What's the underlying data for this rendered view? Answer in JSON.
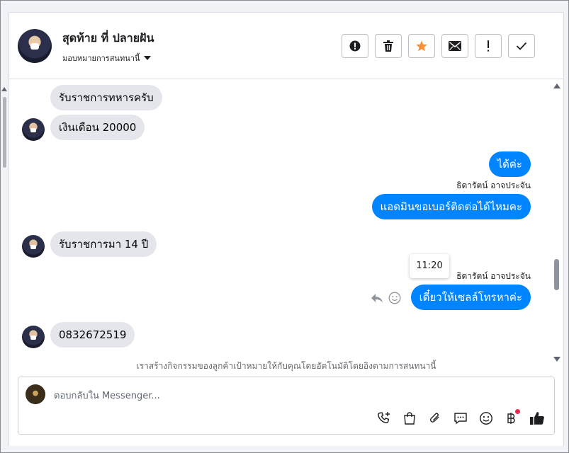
{
  "header": {
    "contact_name": "สุดท้าย ที่ ปลายฝัน",
    "assign_label": "มอบหมายการสนทนานี้",
    "actions": [
      {
        "name": "spam-icon-button",
        "icon": "alert-circle-icon"
      },
      {
        "name": "delete-button",
        "icon": "trash-icon"
      },
      {
        "name": "star-button",
        "icon": "star-icon"
      },
      {
        "name": "mark-unread-button",
        "icon": "envelope-icon"
      },
      {
        "name": "follow-up-button",
        "icon": "exclamation-icon"
      },
      {
        "name": "mark-done-button",
        "icon": "check-icon"
      }
    ]
  },
  "messages": {
    "m1": "รับราชการทหารครับ",
    "m2": "เงินเดือน 20000",
    "m3": "ได้ค่ะ",
    "sender1": "ธิดารัตน์ อาจประจัน",
    "m4": "แอดมินขอเบอร์ติดต่อได้ไหมคะ",
    "m5": "รับราชการมา 14 ปี",
    "tooltip_time": "11:20",
    "sender2": "ธิดารัตน์ อาจประจัน",
    "m6": "เดี๋ยวให้เซลล์โทรหาค่ะ",
    "m7": "0832672519"
  },
  "notice": "เราสร้างกิจกรรมของลูกค้าเป้าหมายให้กับคุณโดยอัตโนมัติโดยอิงตามการสนทนานี้",
  "composer": {
    "placeholder": "ตอบกลับใน Messenger...",
    "tools": [
      "phone-add-icon",
      "shopping-bag-icon",
      "paperclip-icon",
      "chat-bubble-icon",
      "smiley-icon",
      "baht-icon",
      "thumbs-up-icon"
    ]
  },
  "colors": {
    "outgoing": "#0084ff",
    "incoming": "#e4e6eb",
    "star": "#f7923a",
    "badge": "#f02849"
  }
}
